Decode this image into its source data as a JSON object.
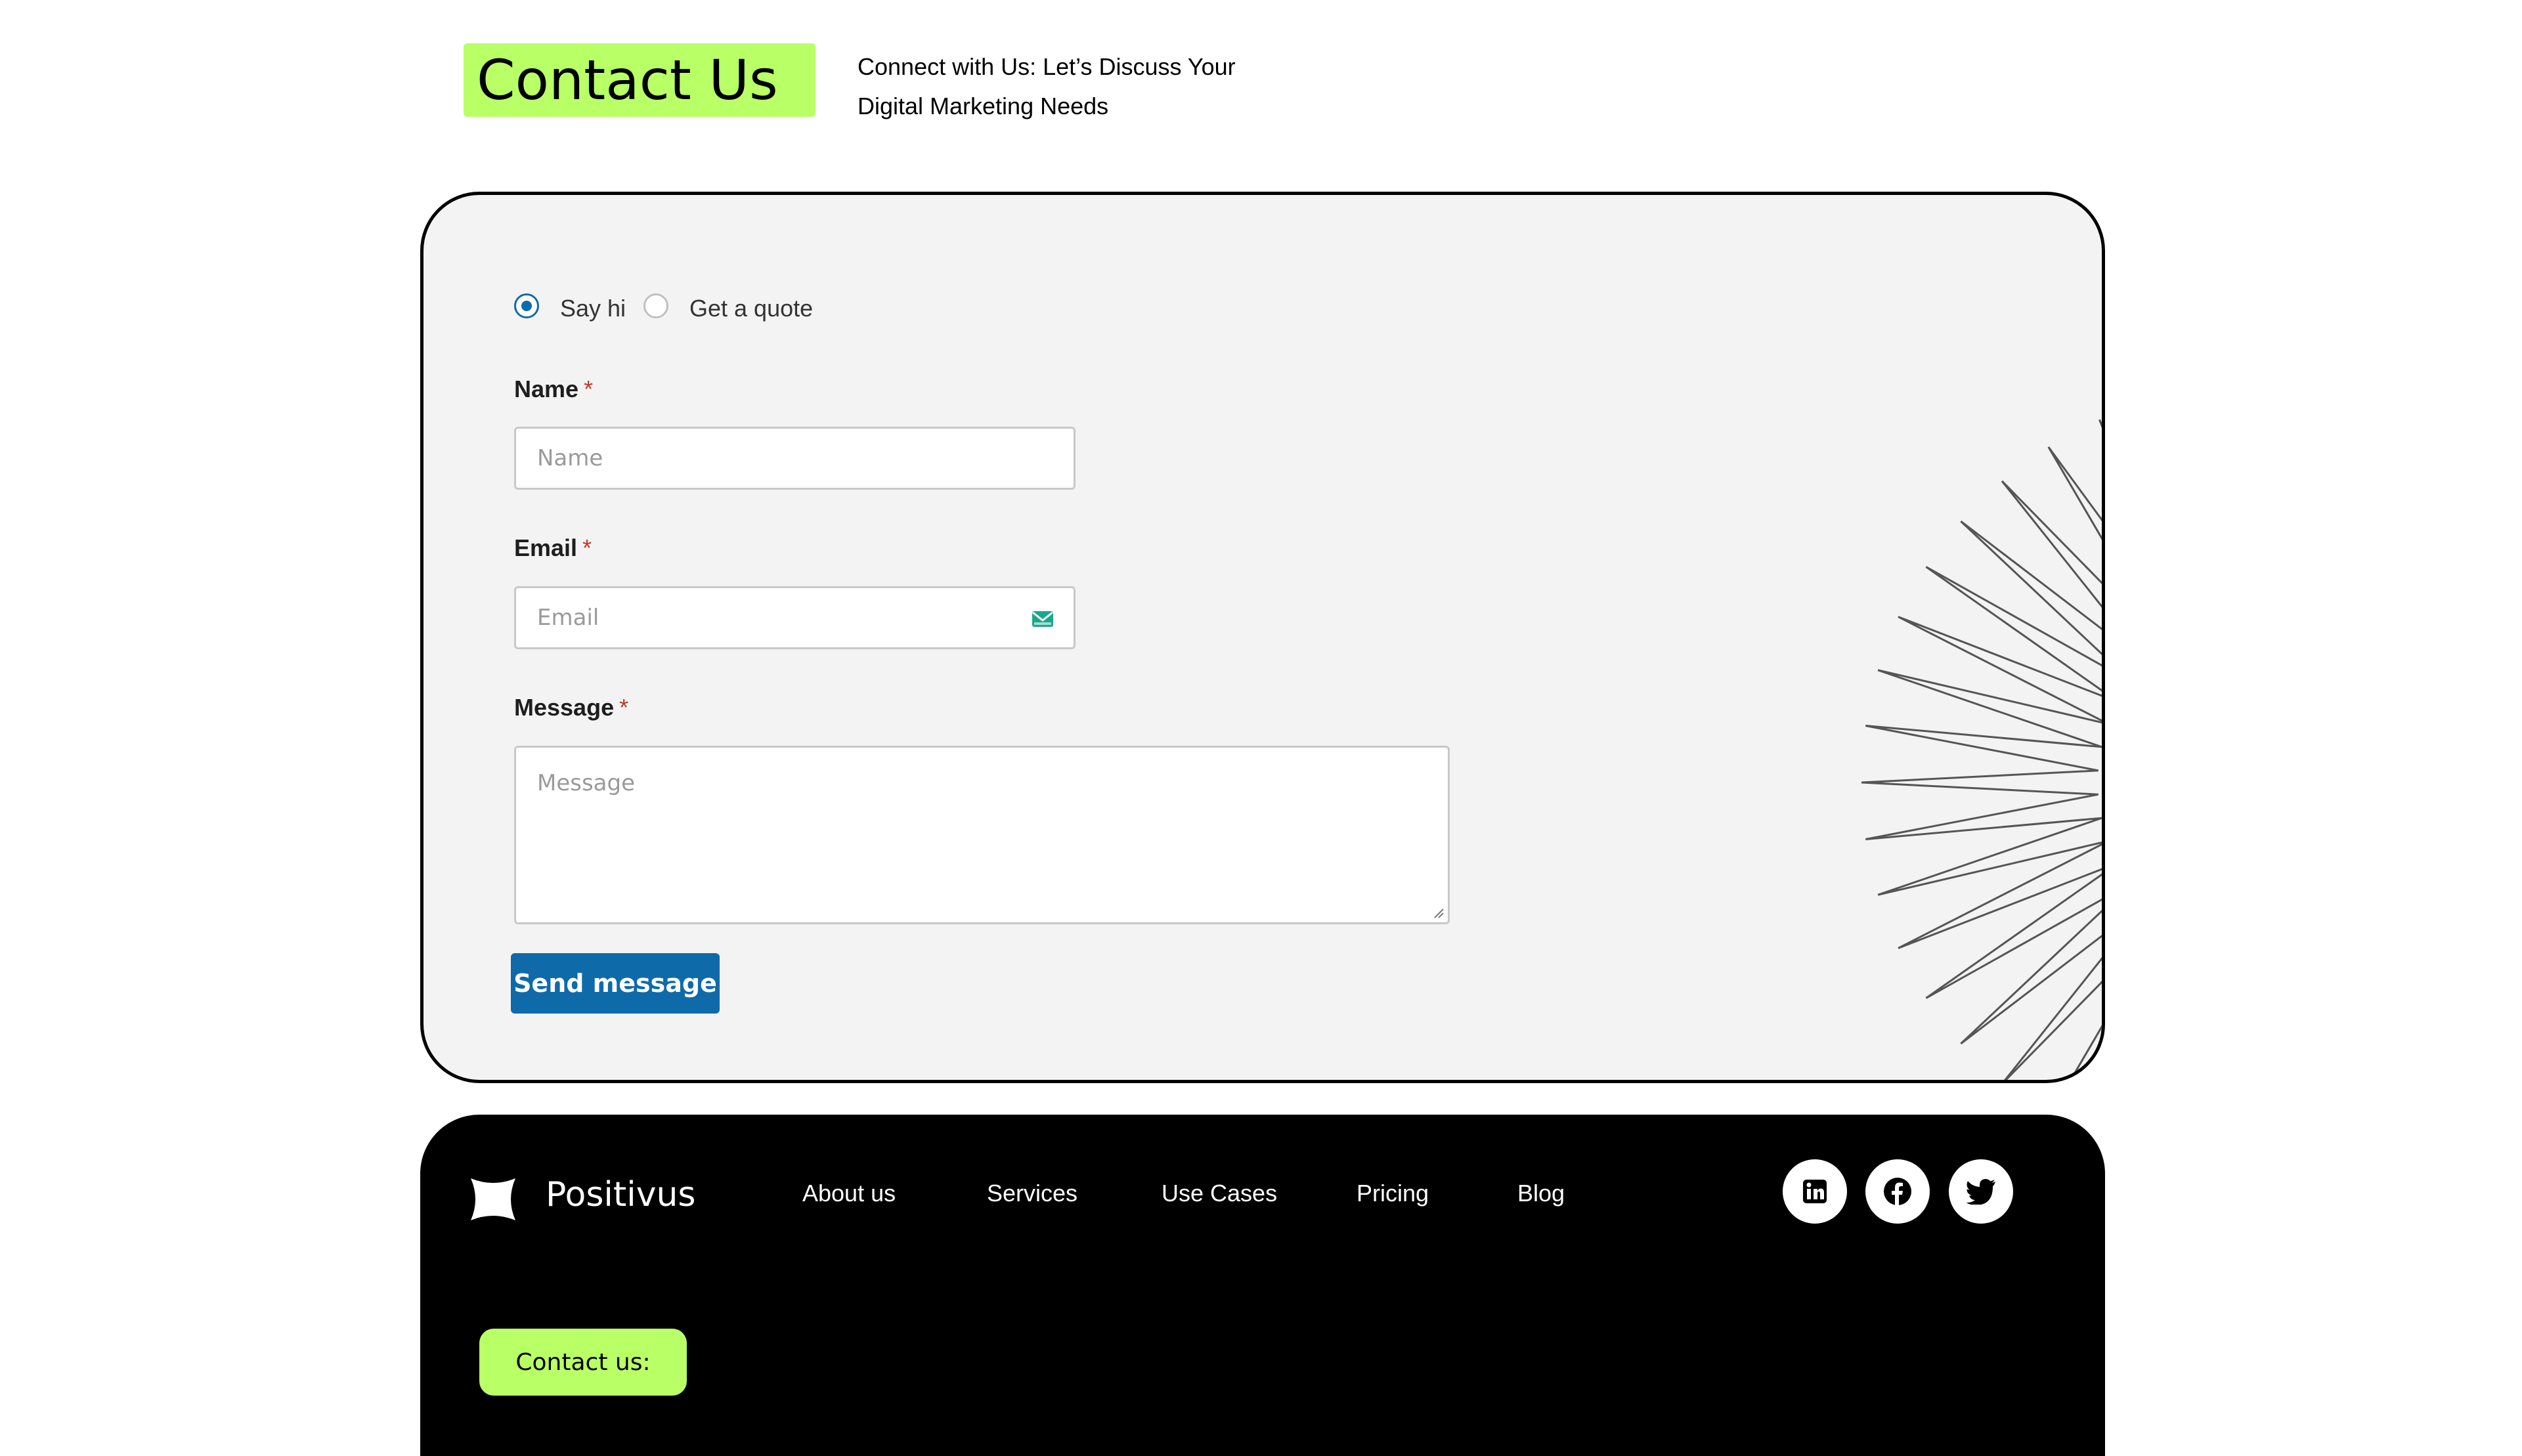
{
  "header": {
    "title": "Contact Us",
    "subtitle_line1": "Connect with Us: Let’s Discuss Your",
    "subtitle_line2": "Digital Marketing Needs"
  },
  "form": {
    "radio_options": [
      {
        "label": "Say hi",
        "checked": true
      },
      {
        "label": "Get a quote",
        "checked": false
      }
    ],
    "name": {
      "label": "Name",
      "required": "*",
      "placeholder": "Name"
    },
    "email": {
      "label": "Email",
      "required": "*",
      "placeholder": "Email",
      "icon": "envelope-icon"
    },
    "message": {
      "label": "Message",
      "required": "*",
      "placeholder": "Message"
    },
    "submit_label": "Send message"
  },
  "footer": {
    "brand": "Positivus",
    "nav": [
      "About us",
      "Services",
      "Use Cases",
      "Pricing",
      "Blog"
    ],
    "social": [
      "linkedin-icon",
      "facebook-icon",
      "twitter-icon"
    ],
    "contact_label": "Contact us:"
  },
  "colors": {
    "accent_green": "#b9ff66",
    "primary_blue": "#0f6aaa",
    "dark": "#141422",
    "card_bg": "#f3f3f3"
  }
}
